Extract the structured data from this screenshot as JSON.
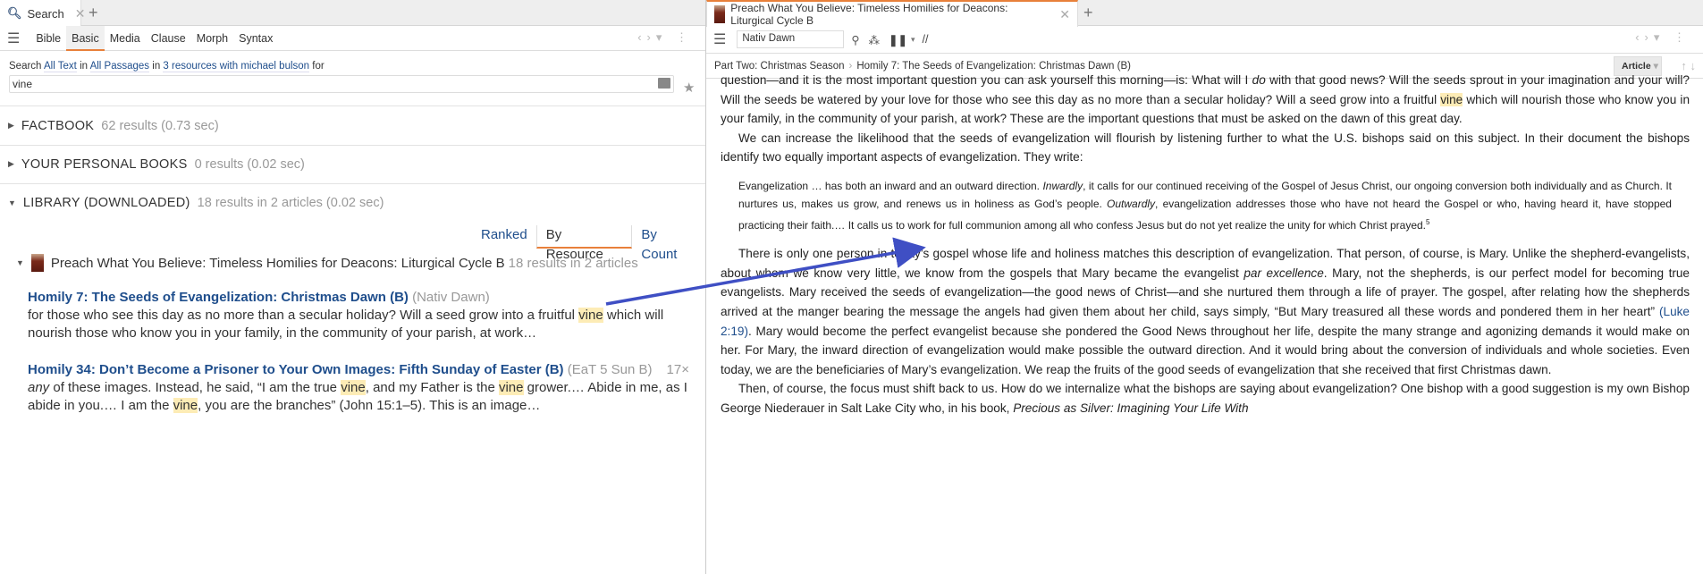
{
  "left": {
    "tab": {
      "icon": "search-icon",
      "label": "Search"
    },
    "modes": [
      "Bible",
      "Basic",
      "Media",
      "Clause",
      "Morph",
      "Syntax"
    ],
    "active_mode": "Basic",
    "search_line": {
      "prefix": "Search",
      "scope": "All Text",
      "in1": "in",
      "passages": "All Passages",
      "in2": "in",
      "resources": "3 resources with michael bulson",
      "suffix": "for"
    },
    "query": "vine",
    "sections": [
      {
        "name": "FACTBOOK",
        "meta": "62 results (0.73 sec)"
      },
      {
        "name": "YOUR PERSONAL BOOKS",
        "meta": "0 results (0.02 sec)"
      },
      {
        "name": "LIBRARY (DOWNLOADED)",
        "meta": "18 results in 2 articles (0.02 sec)"
      }
    ],
    "sorts": [
      "Ranked",
      "By Resource",
      "By Count"
    ],
    "active_sort": "By Resource",
    "book": {
      "title": "Preach What You Believe: Timeless Homilies for Deacons: Liturgical Cycle B",
      "meta": "18 results in 2 articles"
    },
    "results": [
      {
        "title": "Homily 7: The Seeds of Evangelization: Christmas Dawn (B)",
        "tag": "(Nativ Dawn)",
        "count": "",
        "runs": [
          [
            "for those who see this day as no more than a secular holiday? Will a seed grow into a fruitful ",
            ""
          ],
          [
            "vine",
            "hl"
          ],
          [
            " which will nourish those who know you in your family, in the community of your parish, at work…",
            ""
          ]
        ]
      },
      {
        "title": "Homily 34: Don’t Become a Prisoner to Your Own Images: Fifth Sunday of Easter (B)",
        "tag": "(EaT 5 Sun B)",
        "count": "17×",
        "runs": [
          [
            "any",
            "i"
          ],
          [
            " of these images. Instead, he said, “I am the true ",
            ""
          ],
          [
            "vine",
            "hl"
          ],
          [
            ", and my Father is the ",
            ""
          ],
          [
            "vine",
            "hl"
          ],
          [
            " grower.… Abide in me, as I abide in you.… I am the ",
            ""
          ],
          [
            "vine",
            "hl"
          ],
          [
            ", you are the branches” (John 15:1–5). This is an image…",
            ""
          ]
        ]
      }
    ]
  },
  "right": {
    "tab": {
      "label": "Preach What You Believe: Timeless Homilies for Deacons: Liturgical Cycle B"
    },
    "reference": "Nativ Dawn",
    "breadcrumb": [
      "Part Two: Christmas Season",
      "Homily 7: The Seeds of Evangelization: Christmas Dawn (B)"
    ],
    "view": "Article",
    "paragraphs": [
      {
        "cls": "",
        "runs": [
          [
            "question—and it is the most important question you can ask yourself this morning—is: What will I ",
            ""
          ],
          [
            "do",
            "i"
          ],
          [
            " with that good news? Will the seeds sprout in your imagination and your will? Will the seeds be watered by your love for those who see this day as no more than a secular holiday? Will a seed grow into a fruitful ",
            ""
          ],
          [
            "vine",
            "hl"
          ],
          [
            " which will nourish those who know you in your family, in the community of your parish, at work? These are the important questions that must be asked on the dawn of this great day.",
            ""
          ]
        ]
      },
      {
        "cls": "ind",
        "runs": [
          [
            "We can increase the likelihood that the seeds of evangelization will flourish by listening further to what the U.S. bishops said on this subject. In their document the bishops identify two equally important aspects of evangelization. They write:",
            ""
          ]
        ]
      },
      {
        "cls": "quote",
        "runs": [
          [
            "Evangelization … has both an inward and an outward direction. ",
            ""
          ],
          [
            "Inwardly",
            "i"
          ],
          [
            ", it calls for our continued receiving of the Gospel of Jesus Christ, our ongoing conversion both individually and as Church. It nurtures us, makes us grow, and renews us in holiness as God’s people. ",
            ""
          ],
          [
            "Outwardly",
            "i"
          ],
          [
            ", evangelization addresses those who have not heard the Gospel or who, having heard it, have stopped practicing their faith.… It calls us to work for full communion among all who confess Jesus but do not yet realize the unity for which Christ prayed.",
            ""
          ],
          [
            "5",
            "sup"
          ]
        ]
      },
      {
        "cls": "ind",
        "runs": [
          [
            "There is only one person in today’s gospel whose life and holiness matches this description of evangelization. That person, of course, is Mary. Unlike the shepherd-evangelists, about whom we know very little, we know from the gospels that Mary became the evangelist ",
            ""
          ],
          [
            "par excellence",
            "i"
          ],
          [
            ". Mary, not the shepherds, is our perfect model for becoming true evangelists. Mary received the seeds of evangelization—the good news of Christ—and she nurtured them through a life of prayer. The gospel, after relating how the shepherds arrived at the manger bearing the message the angels had given them about her child, says simply, “But Mary treasured all these words and pondered them in her heart” ",
            ""
          ],
          [
            "(Luke 2:19)",
            "lnk"
          ],
          [
            ". Mary would become the perfect evangelist because she pondered the Good News throughout her life, despite the many strange and agonizing demands it would make on her. For Mary, the inward direction of evangelization would make possible the outward direction. And it would bring about the conversion of individuals and whole societies. Even today, we are the beneficiaries of Mary’s evangelization. We reap the fruits of the good seeds of evangelization that she received that first Christmas dawn.",
            ""
          ]
        ]
      },
      {
        "cls": "ind",
        "runs": [
          [
            "Then, of course, the focus must shift back to us. How do we internalize what the bishops are saying about evangelization? One bishop with a good suggestion is my own Bishop George Niederauer in Salt Lake City who, in his book, ",
            ""
          ],
          [
            "Precious as Silver: Imagining Your Life With",
            "i"
          ]
        ]
      }
    ]
  },
  "colors": {
    "accent": "#e8803a",
    "link": "#1f4e8c",
    "highlight": "#fdecb6",
    "arrow": "#3f4fc4"
  }
}
